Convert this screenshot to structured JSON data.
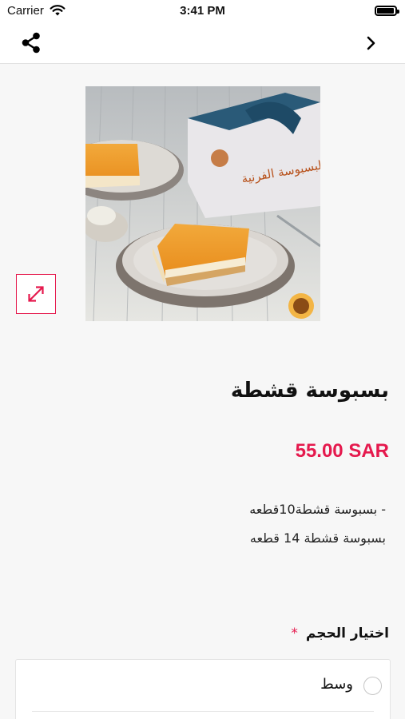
{
  "status_bar": {
    "carrier": "Carrier",
    "time": "3:41 PM",
    "battery_level": 0.95
  },
  "nav": {
    "share_icon": "share-icon",
    "back_icon": "chevron-right-icon"
  },
  "product": {
    "title": "بسبوسة قشطة",
    "price": "55.00 SAR",
    "description_lines": [
      "بسبوسة قشطة10قطعه -",
      "بسبوسة قشطة 14 قطعه"
    ],
    "image_logo_text": "البسبوسة الفرنية"
  },
  "options": {
    "label": "اختيار الحجم",
    "required_mark": "*",
    "items": [
      {
        "label": "وسط",
        "selected": false
      }
    ]
  },
  "colors": {
    "accent": "#e5194d",
    "background": "#f7f7f7"
  }
}
